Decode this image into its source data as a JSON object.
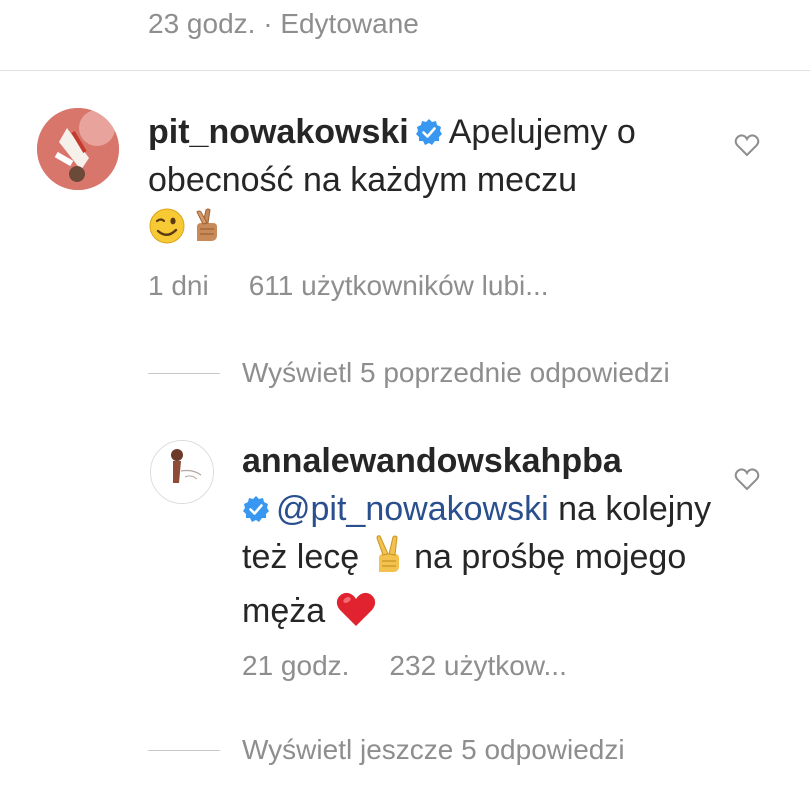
{
  "previous_comment": {
    "time": "23 godz.",
    "separator": " · ",
    "edited": "Edytowane"
  },
  "main_comment": {
    "username": "pit_nowakowski",
    "verified": true,
    "text_line": "Apelujemy o obecność na każdym meczu",
    "emojis": [
      "winking-face",
      "crossed-fingers"
    ],
    "time": "1 dni",
    "likes": "611 użytkowników lubi...",
    "heart_icon": "heart-outline-icon"
  },
  "view_previous_replies": "Wyświetl 5 poprzednie odpowiedzi",
  "reply": {
    "username": "annalewandowskahpba",
    "verified": true,
    "mention": "@pit_nowakowski",
    "text_part1": " na kolejny też lecę ",
    "text_part2": " na prośbę mojego męża ",
    "emojis": [
      "victory-hand",
      "red-heart"
    ],
    "time": "21 godz.",
    "likes": "232 użytkow...",
    "heart_icon": "heart-outline-icon"
  },
  "view_more_replies": "Wyświetl jeszcze 5 odpowiedzi",
  "colors": {
    "text": "#262626",
    "meta": "#8e8e8e",
    "mention": "#2a4f8f",
    "verified": "#3897f0"
  }
}
